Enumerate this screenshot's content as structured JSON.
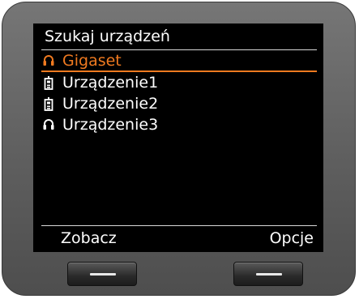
{
  "screen": {
    "title": "Szukaj urządzeń",
    "items": [
      {
        "label": "Gigaset",
        "icon": "headset-icon",
        "selected": true
      },
      {
        "label": "Urządzenie1",
        "icon": "handset-icon",
        "selected": false
      },
      {
        "label": "Urządzenie2",
        "icon": "handset-icon",
        "selected": false
      },
      {
        "label": "Urządzenie3",
        "icon": "headset-icon",
        "selected": false
      }
    ]
  },
  "softkeys": {
    "left": "Zobacz",
    "right": "Opcje"
  },
  "colors": {
    "accent": "#f07a20",
    "screen_bg": "#000000",
    "text": "#ffffff",
    "bezel": "#666666"
  }
}
